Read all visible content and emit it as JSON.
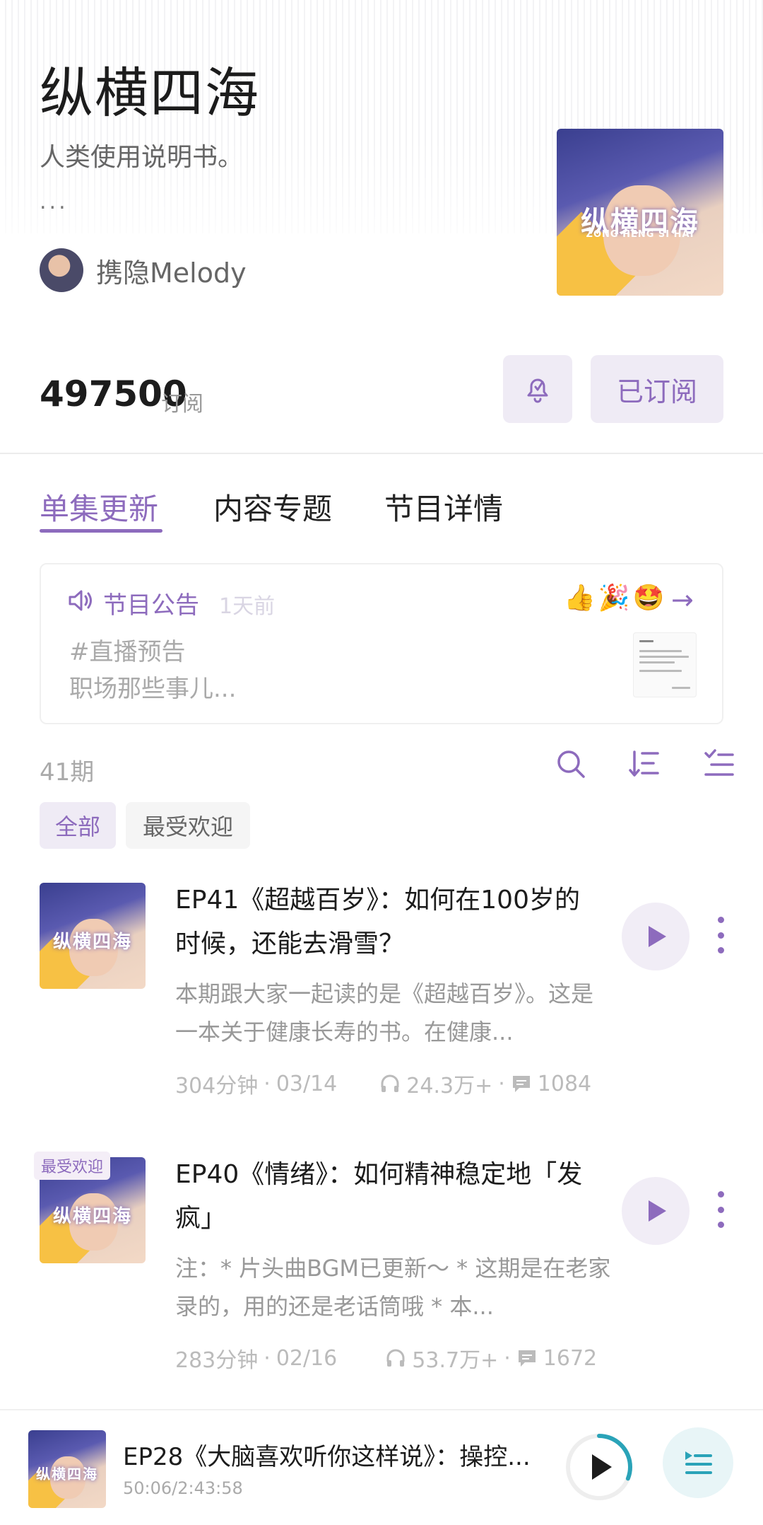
{
  "podcast": {
    "title": "纵横四海",
    "description": "人类使用说明书。",
    "description_more": "...",
    "author": "携隐Melody",
    "cover_text": "纵横四海",
    "cover_subtext": "ZONG HENG SI HAI"
  },
  "stats": {
    "subscribers": "497500",
    "subscribers_label": "订阅"
  },
  "actions": {
    "bell_icon": "bell-check-icon",
    "subscribed_label": "已订阅"
  },
  "tabs": [
    {
      "label": "单集更新",
      "active": true
    },
    {
      "label": "内容专题",
      "active": false
    },
    {
      "label": "节目详情",
      "active": false
    }
  ],
  "notice": {
    "title": "节目公告",
    "time": "1天前",
    "emojis": "👍🎉🤩",
    "line1": "#直播预告",
    "line2": "职场那些事儿..."
  },
  "episode_list": {
    "count": "41期",
    "filters": [
      "全部",
      "最受欢迎"
    ]
  },
  "episodes": [
    {
      "badge": "",
      "title": "EP41《超越百岁》：如何在100岁的时候，还能去滑雪？",
      "description": "本期跟大家一起读的是《超越百岁》。这是一本关于健康长寿的书。在健康...",
      "duration": "304分钟",
      "date": "03/14",
      "plays": "24.3万+",
      "comments": "1084"
    },
    {
      "badge": "最受欢迎",
      "title": "EP40《情绪》：如何精神稳定地「发疯」",
      "description": "注：* 片头曲BGM已更新～ * 这期是在老家录的，用的还是老话筒哦 * 本...",
      "duration": "283分钟",
      "date": "02/16",
      "plays": "53.7万+",
      "comments": "1672"
    }
  ],
  "player": {
    "title": "EP28《大脑喜欢听你这样说》：操控...",
    "time": "50:06/2:43:58",
    "progress": 0.31
  },
  "colors": {
    "accent": "#8d6bbd",
    "accent_bg": "#efebf5",
    "playlist_accent": "#2aa3b8"
  }
}
